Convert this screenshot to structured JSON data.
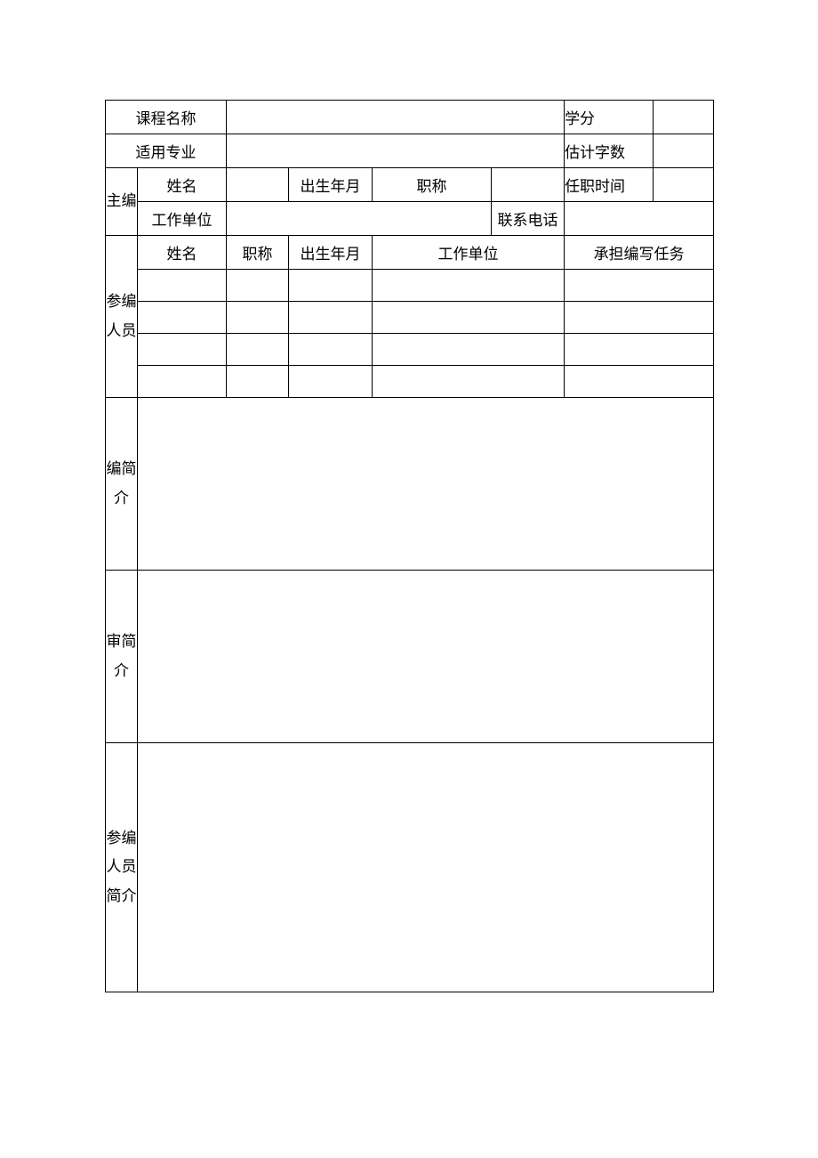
{
  "labels": {
    "course_name": "课程名称",
    "credits": "学分",
    "major": "适用专业",
    "word_count": "估计字数",
    "chief_editor": "主编",
    "name": "姓名",
    "birth": "出生年月",
    "title": "职称",
    "tenure_time": "任职时间",
    "work_unit": "工作单位",
    "contact": "联系电话",
    "contributors": "参编人员",
    "task": "承担编写任务",
    "editor_bio": "编简介",
    "reviewer_bio": "审简介",
    "contributors_bio": "参编人员简介"
  },
  "values": {
    "course_name": "",
    "credits": "",
    "major": "",
    "word_count": "",
    "chief": {
      "name": "",
      "birth": "",
      "title": "",
      "tenure_time": "",
      "work_unit": "",
      "contact": ""
    },
    "contributors": [
      {
        "name": "",
        "title": "",
        "birth": "",
        "work_unit": "",
        "task": ""
      },
      {
        "name": "",
        "title": "",
        "birth": "",
        "work_unit": "",
        "task": ""
      },
      {
        "name": "",
        "title": "",
        "birth": "",
        "work_unit": "",
        "task": ""
      },
      {
        "name": "",
        "title": "",
        "birth": "",
        "work_unit": "",
        "task": ""
      }
    ],
    "editor_bio": "",
    "reviewer_bio": "",
    "contributors_bio": ""
  }
}
